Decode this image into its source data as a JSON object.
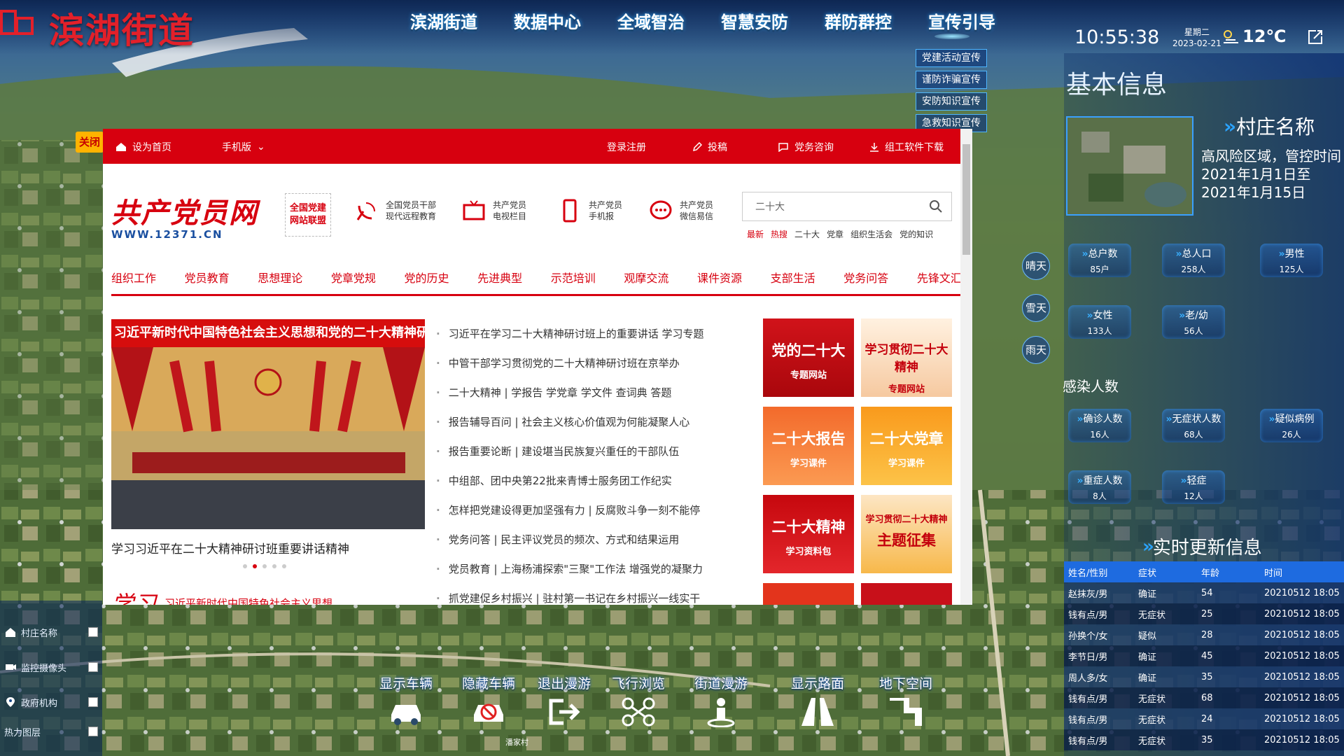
{
  "app": {
    "title": "滨湖街道"
  },
  "nav": {
    "items": [
      "滨湖街道",
      "数据中心",
      "全域智治",
      "智慧安防",
      "群防群控",
      "宣传引导"
    ]
  },
  "submenu": {
    "items": [
      "党建活动宣传",
      "谨防诈骗宣传",
      "安防知识宣传",
      "急救知识宣传"
    ]
  },
  "header": {
    "time": "10:55:38",
    "weekday": "星期二",
    "date": "2023-02-21",
    "temperature": "12℃"
  },
  "info_panel": {
    "title": "基本信息",
    "village_label": "村庄名称",
    "village_desc": "高风险区域，管控时间2021年1月1日至2021年1月15日",
    "stats": [
      {
        "label": "总户数",
        "value": "85户"
      },
      {
        "label": "总人口",
        "value": "258人"
      },
      {
        "label": "男性",
        "value": "125人"
      },
      {
        "label": "女性",
        "value": "133人"
      },
      {
        "label": "老/幼",
        "value": "56人"
      }
    ],
    "infection_title": "感染人数",
    "infection_stats": [
      {
        "label": "确诊人数",
        "value": "16人"
      },
      {
        "label": "无症状人数",
        "value": "68人"
      },
      {
        "label": "疑似病例",
        "value": "26人"
      },
      {
        "label": "重症人数",
        "value": "8人"
      },
      {
        "label": "轻症",
        "value": "12人"
      }
    ]
  },
  "weather_buttons": [
    "晴天",
    "雪天",
    "雨天"
  ],
  "realtime": {
    "title": "实时更新信息",
    "columns": [
      "姓名/性别",
      "症状",
      "年龄",
      "时间"
    ],
    "rows": [
      [
        "赵抹灰/男",
        "确证",
        "54",
        "20210512 18:05"
      ],
      [
        "钱有点/男",
        "无症状",
        "25",
        "20210512 18:05"
      ],
      [
        "孙换个/女",
        "疑似",
        "28",
        "20210512 18:05"
      ],
      [
        "李节日/男",
        "确证",
        "45",
        "20210512 18:05"
      ],
      [
        "周人多/女",
        "确证",
        "35",
        "20210512 18:05"
      ],
      [
        "钱有点/男",
        "无症状",
        "68",
        "20210512 18:05"
      ],
      [
        "钱有点/男",
        "无症状",
        "24",
        "20210512 18:05"
      ],
      [
        "钱有点/男",
        "无症状",
        "35",
        "20210512 18:05"
      ]
    ]
  },
  "layers": {
    "items": [
      "村庄名称",
      "监控摄像头",
      "政府机构",
      "热力图层"
    ]
  },
  "tools": {
    "items": [
      "显示车辆",
      "隐藏车辆",
      "退出漫游",
      "飞行浏览",
      "街道漫游",
      "显示路面",
      "地下空间"
    ]
  },
  "map_labels": {
    "poi": "潘家村"
  },
  "web": {
    "close_label": "关闭",
    "top_links": [
      "设为首页",
      "手机版",
      "登录注册",
      "投稿",
      "党务咨询",
      "组工软件下载"
    ],
    "brand_name": "共产党员网",
    "brand_url": "WWW.12371.CN",
    "alliance": "全国党建网站联盟",
    "icons": [
      {
        "l1": "全国党员干部",
        "l2": "现代远程教育"
      },
      {
        "l1": "共产党员",
        "l2": "电视栏目"
      },
      {
        "l1": "共产党员",
        "l2": "手机报"
      },
      {
        "l1": "共产党员",
        "l2": "微信易信"
      }
    ],
    "search_value": "二十大",
    "hot_words": [
      "最新",
      "热搜",
      "二十大",
      "党章",
      "组织生活会",
      "党的知识"
    ],
    "menu": [
      "组织工作",
      "党员教育",
      "思想理论",
      "党章党规",
      "党的历史",
      "先进典型",
      "示范培训",
      "观摩交流",
      "课件资源",
      "支部生活",
      "党务问答",
      "先锋文汇"
    ],
    "banner_text": "习近平新时代中国特色社会主义思想和党的二十大精神研讨班",
    "caption": "学习习近平在二十大精神研讨班重要讲话精神",
    "news": [
      "习近平在学习二十大精神研讨班上的重要讲话 学习专题",
      "中管干部学习贯彻党的二十大精神研讨班在京举办",
      "二十大精神 | 学报告  学党章  学文件  查词典  答题",
      "报告辅导百问 | 社会主义核心价值观为何能凝聚人心",
      "报告重要论断 | 建设堪当民族复兴重任的干部队伍",
      "中组部、团中央第22批来青博士服务团工作纪实",
      "怎样把党建设得更加坚强有力 | 反腐败斗争一刻不能停",
      "党务问答 | 民主评议党员的频次、方式和结果运用",
      "党员教育 | 上海杨浦探索\"三聚\"工作法 增强党的凝聚力",
      "抓党建促乡村振兴 | 驻村第一书记在乡村振兴一线实干"
    ],
    "promos": [
      {
        "l1": "党的二十大",
        "l2": "专题网站"
      },
      {
        "l1": "学习贯彻二十大精神",
        "l2": "专题网站"
      },
      {
        "l1": "二十大报告",
        "l2": "学习课件"
      },
      {
        "l1": "二十大党章",
        "l2": "学习课件"
      },
      {
        "l1": "二十大精神",
        "l2": "学习资料包"
      },
      {
        "l1": "学习贯彻二十大精神",
        "l2": "主题征集"
      }
    ],
    "study_brand": "学习",
    "study_text": "习近平新时代中国特色社会主义思想"
  }
}
